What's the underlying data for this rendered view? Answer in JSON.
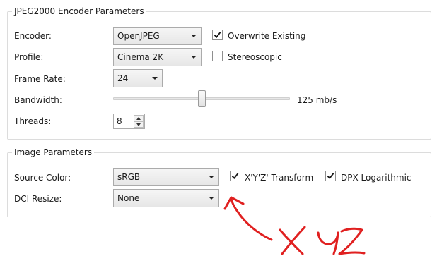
{
  "encoder_group": {
    "title": "JPEG2000 Encoder Parameters",
    "encoder_label": "Encoder:",
    "encoder_value": "OpenJPEG",
    "profile_label": "Profile:",
    "profile_value": "Cinema 2K",
    "frame_rate_label": "Frame Rate:",
    "frame_rate_value": "24",
    "bandwidth_label": "Bandwidth:",
    "bandwidth_value": "125 mb/s",
    "bandwidth_slider_fraction": 0.5,
    "threads_label": "Threads:",
    "threads_value": "8",
    "overwrite_label": "Overwrite Existing",
    "overwrite_checked": true,
    "stereoscopic_label": "Stereoscopic",
    "stereoscopic_checked": false
  },
  "image_group": {
    "title": "Image Parameters",
    "source_color_label": "Source Color:",
    "source_color_value": "sRGB",
    "dci_resize_label": "DCI Resize:",
    "dci_resize_value": "None",
    "xyz_transform_label": "X'Y'Z' Transform",
    "xyz_transform_checked": true,
    "dpx_log_label": "DPX Logarithmic",
    "dpx_log_checked": true
  },
  "annotation": {
    "text": "XYZ",
    "color": "#e02020"
  },
  "icons": {
    "check": "check-icon",
    "dropdown": "chevron-down-icon",
    "spin_up": "spin-up-icon",
    "spin_down": "spin-down-icon"
  }
}
